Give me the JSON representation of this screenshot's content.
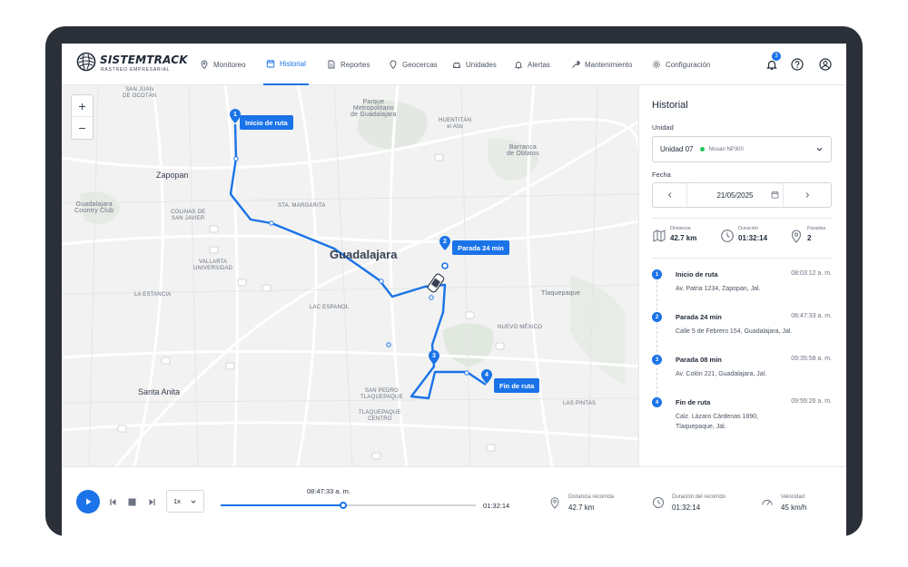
{
  "brand": {
    "name": "SISTEMTRACK",
    "tagline": "RASTREO EMPRESARIAL"
  },
  "nav": {
    "items": [
      {
        "label": "Monitoreo",
        "icon": "location-pin-icon"
      },
      {
        "label": "Historial",
        "icon": "calendar-icon",
        "active": true
      },
      {
        "label": "Reportes",
        "icon": "document-icon"
      },
      {
        "label": "Geocercas",
        "icon": "geofence-pin-icon"
      },
      {
        "label": "Unidades",
        "icon": "car-icon"
      },
      {
        "label": "Alertas",
        "icon": "bell-icon"
      },
      {
        "label": "Mantenimiento",
        "icon": "wrench-icon"
      },
      {
        "label": "Configuración",
        "icon": "gear-icon"
      }
    ],
    "notifications_count": "3"
  },
  "map": {
    "zoom_in": "+",
    "zoom_out": "−",
    "labels": {
      "san_juan": "SAN JUAN\nDE OCOTÁN",
      "parque": "Parque\nMetropolitano\nde Guadalajara",
      "huentitan": "HUENTITÁN\nel Alto",
      "barranca": "Barranca\nde Oblatos",
      "zapopan": "Zapopan",
      "guadalajara_cc": "Guadalajara\nCountry Club",
      "colinas": "COLINAS DE\nSAN JAVIER",
      "sta_margarita": "STA. MARGARITA",
      "guadalajara": "Guadalajara",
      "vallarta": "VALLARTA\nUNIVERSIDAD",
      "la_estancia": "LA ESTANCIA",
      "lac_espanol": "LAC ESPANOL",
      "tlaquepaque": "Tlaquepaque",
      "nuevo_mexico": "NUEVO MÉXICO",
      "santa_anita": "Santa Anita",
      "san_pedro": "SAN PEDRO\nTLAQUEPAQUE",
      "tlaquepaque_centro": "TLAQUEPAQUE\nCENTRO",
      "las_pintas": "LAS PINTAS",
      "nuevo_mexico_small": "NUEVO MÉXICO"
    },
    "pins": [
      {
        "n": "1",
        "label": "Inicio de ruta"
      },
      {
        "n": "2",
        "label": "Parada 24 min"
      },
      {
        "n": "3",
        "label": ""
      },
      {
        "n": "4",
        "label": "Fin de ruta"
      }
    ]
  },
  "sidebar": {
    "title": "Historial",
    "unit_label": "Unidad",
    "unit_value": "Unidad 07",
    "unit_model": "Nissan NP300",
    "date_label": "Fecha",
    "date_value": "21/05/2025",
    "stats": [
      {
        "label": "Distancia",
        "value": "42.7 km",
        "icon": "map-distance-icon"
      },
      {
        "label": "Duración",
        "value": "01:32:14",
        "icon": "clock-icon"
      },
      {
        "label": "Paradas",
        "value": "2",
        "icon": "location-pin-icon"
      }
    ],
    "timeline": [
      {
        "n": "1",
        "title": "Inicio de ruta",
        "time": "08:03:12 a. m.",
        "address": "Av. Patria 1234, Zapopan, Jal."
      },
      {
        "n": "2",
        "title": "Parada 24 min",
        "time": "08:47:33 a. m.",
        "address": "Calle 5 de Febrero 154, Guadalajara, Jal."
      },
      {
        "n": "3",
        "title": "Parada 08 min",
        "time": "09:35:58 a. m.",
        "address": "Av. Colón 221, Guadalajara, Jal."
      },
      {
        "n": "4",
        "title": "Fin de ruta",
        "time": "09:55:26 a. m.",
        "address": "Calz. Lázaro Cárdenas 1890, Tlaquepaque, Jal."
      }
    ]
  },
  "player": {
    "speed": "1x",
    "current_time": "08:47:33 a. m.",
    "end_time": "01:32:14",
    "progress": 0.48,
    "stats": [
      {
        "label": "Distancia recorrida",
        "value": "42.7 km",
        "icon": "location-pin-icon"
      },
      {
        "label": "Duración del recorrido",
        "value": "01:32:14",
        "icon": "clock-icon"
      },
      {
        "label": "Velocidad",
        "value": "45 km/h",
        "icon": "speedometer-icon"
      }
    ]
  },
  "colors": {
    "accent": "#1a73e8",
    "status_online": "#22c55e"
  }
}
